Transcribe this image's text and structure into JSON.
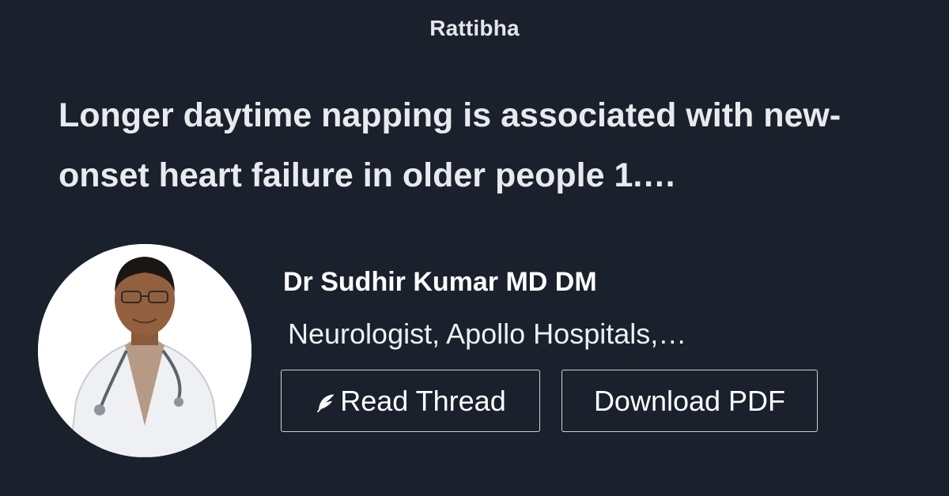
{
  "brand": {
    "name": "Rattibha"
  },
  "thread": {
    "title": "Longer daytime napping is associated with new-onset heart failure in older people 1.…"
  },
  "author": {
    "name": "Dr Sudhir Kumar MD DM",
    "bio": "Neurologist, Apollo Hospitals,…",
    "avatar_icon": "doctor-portrait"
  },
  "actions": {
    "read_thread_label": "Read Thread",
    "read_thread_icon": "feather-icon",
    "download_pdf_label": "Download PDF"
  },
  "colors": {
    "background": "#1a202c",
    "text": "#ffffff",
    "button_border": "#cfd3d9"
  }
}
